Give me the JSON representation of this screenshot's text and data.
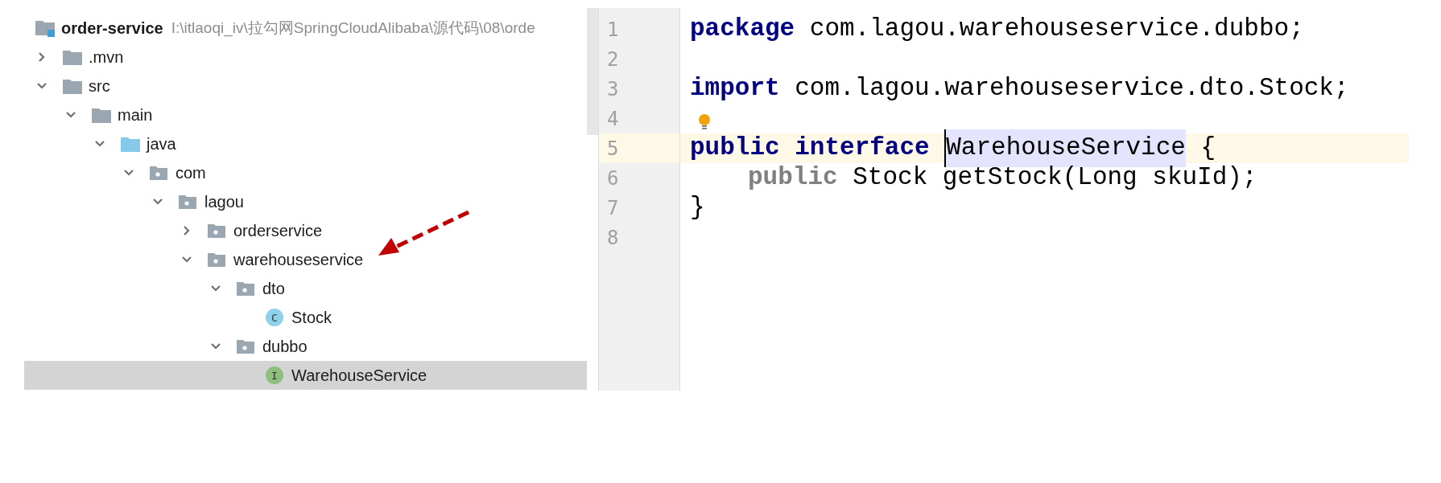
{
  "project": {
    "name": "order-service",
    "path": "I:\\itlaoqi_iv\\拉勾网SpringCloudAlibaba\\源代码\\08\\orde"
  },
  "tree": [
    {
      "label": ".mvn",
      "kind": "folder",
      "expanded": false,
      "selected": false
    },
    {
      "label": "src",
      "kind": "folder",
      "expanded": true,
      "selected": false,
      "children": [
        {
          "label": "main",
          "kind": "folder",
          "expanded": true,
          "selected": false,
          "children": [
            {
              "label": "java",
              "kind": "source-folder",
              "expanded": true,
              "selected": false,
              "children": [
                {
                  "label": "com",
                  "kind": "package",
                  "expanded": true,
                  "selected": false,
                  "children": [
                    {
                      "label": "lagou",
                      "kind": "package",
                      "expanded": true,
                      "selected": false,
                      "children": [
                        {
                          "label": "orderservice",
                          "kind": "package",
                          "expanded": false,
                          "selected": false
                        },
                        {
                          "label": "warehouseservice",
                          "kind": "package",
                          "expanded": true,
                          "selected": false,
                          "children": [
                            {
                              "label": "dto",
                              "kind": "package",
                              "expanded": true,
                              "selected": false,
                              "children": [
                                {
                                  "label": "Stock",
                                  "kind": "class",
                                  "badge": "C",
                                  "selected": false
                                }
                              ]
                            },
                            {
                              "label": "dubbo",
                              "kind": "package",
                              "expanded": true,
                              "selected": false,
                              "children": [
                                {
                                  "label": "WarehouseService",
                                  "kind": "interface",
                                  "badge": "I",
                                  "selected": true
                                }
                              ]
                            }
                          ]
                        }
                      ]
                    }
                  ]
                }
              ]
            }
          ]
        }
      ]
    }
  ],
  "editor": {
    "lines": [
      {
        "number": "1",
        "current": false,
        "intention": false,
        "tokens": [
          {
            "kind": "keyword",
            "text": "package"
          },
          {
            "kind": "plain",
            "text": " com.lagou.warehouseservice.dubbo;"
          }
        ]
      },
      {
        "number": "2",
        "current": false,
        "intention": false
      },
      {
        "number": "3",
        "current": false,
        "intention": false,
        "tokens": [
          {
            "kind": "keyword",
            "text": "import"
          },
          {
            "kind": "plain",
            "text": " com.lagou.warehouseservice.dto.Stock;"
          }
        ]
      },
      {
        "number": "4",
        "current": false,
        "intention": true
      },
      {
        "number": "5",
        "current": true,
        "intention": false,
        "tokens": [
          {
            "kind": "keyword",
            "text": "public interface "
          },
          {
            "kind": "highlight",
            "text": "WarehouseService",
            "caret": true
          },
          {
            "kind": "plain",
            "text": " {"
          }
        ]
      },
      {
        "number": "6",
        "current": false,
        "intention": false,
        "indented": true,
        "tokens": [
          {
            "kind": "unused-keyword",
            "text": "public"
          },
          {
            "kind": "plain",
            "text": " Stock getStock(Long skuId);"
          }
        ]
      },
      {
        "number": "7",
        "current": false,
        "intention": false,
        "tokens": [
          {
            "kind": "plain",
            "text": "}"
          }
        ]
      },
      {
        "number": "8",
        "current": false,
        "intention": false
      }
    ]
  }
}
